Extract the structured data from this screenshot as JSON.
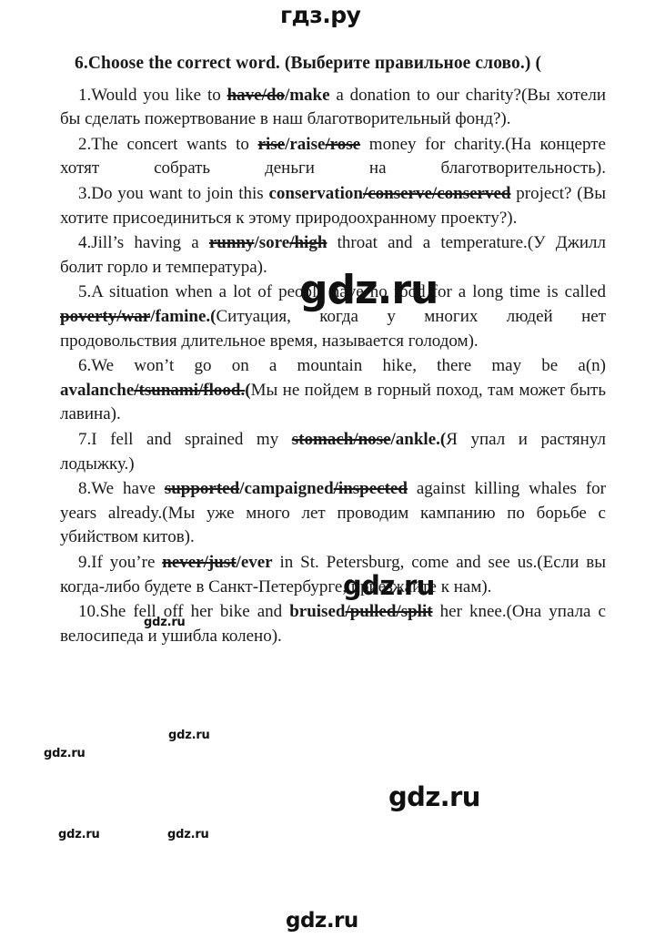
{
  "site": {
    "logo_text": "гдз.ру",
    "watermark_text": "gdz.ru"
  },
  "exercise": {
    "title_en": "6.Choose the correct word.",
    "title_ru": "(Выберите правильное слово.)",
    "title_trailing": "(",
    "items": [
      {
        "number": "1.",
        "lead_en": "Would you like to ",
        "struck": "have/do",
        "sep": "/",
        "chosen": "make",
        "tail_en": " a donation to our charity?",
        "translation": "(Вы хотели бы сделать пожертвование в наш благотворительный фонд?)."
      },
      {
        "number": "2.",
        "lead_en": "The concert wants to ",
        "struck": "rise",
        "sep": "/",
        "chosen": "raise",
        "struck2": "/rose",
        "tail_en": " money for charity.",
        "translation": "(На концерте хотят собрать деньги на благотворительность)."
      },
      {
        "number": "3.",
        "lead_en": "Do you want to join this ",
        "chosen": "conservation",
        "struck": "/conserve/conserved",
        "tail_en": " project?",
        "translation": " (Вы хотите присоединиться к этому природоохранному проекту?)."
      },
      {
        "number": "4.",
        "lead_en": "Jill’s having a ",
        "struck": "runny",
        "sep": "/",
        "chosen": "sore",
        "struck2": "/high",
        "tail_en": " throat and a temperature.",
        "translation": "(У Джилл болит горло и температура)."
      },
      {
        "number": "5.",
        "lead_en": "A situation when a lot of people have no food for a long time is called ",
        "struck": "poverty/war",
        "sep": "/",
        "chosen": "famine.(",
        "translation": "Ситуация, когда у многих людей нет продовольствия длительное время, называется голодом)."
      },
      {
        "number": "6.",
        "lead_en": "We won’t go on a mountain hike, there may be a(n) ",
        "chosen": "avalanche",
        "struck": "/tsunami/flood.",
        "chosen2": "(",
        "translation": "Мы не пойдем в горный поход, там может быть лавина)."
      },
      {
        "number": "7.",
        "lead_en": "I fell and sprained my ",
        "struck": "stomach/nose",
        "sep": "/",
        "chosen": "ankle.(",
        "translation": "Я упал и растянул лодыжку.)"
      },
      {
        "number": "8.",
        "lead_en": "We have ",
        "struck": "supported",
        "sep": "/",
        "chosen": "campaigned",
        "struck2": "/inspected",
        "tail_en": " against killing whales for years already.",
        "translation": "(Мы уже много лет проводим кампанию по борьбе с убийством китов)."
      },
      {
        "number": "9.",
        "lead_en": "If you’re ",
        "struck": "never/just",
        "sep": "/",
        "chosen": "ever",
        "tail_en": " in St. Petersburg, come and see us.",
        "translation": "(Если вы когда-либо будете в Санкт-Петербурге, приезжайте к нам)."
      },
      {
        "number": "10.",
        "lead_en": "She fell off her bike and ",
        "chosen": "bruised",
        "struck": "/pulled/split",
        "tail_en": " her knee.",
        "translation": "(Она упала с велосипеда и ушибла колено)."
      }
    ]
  }
}
